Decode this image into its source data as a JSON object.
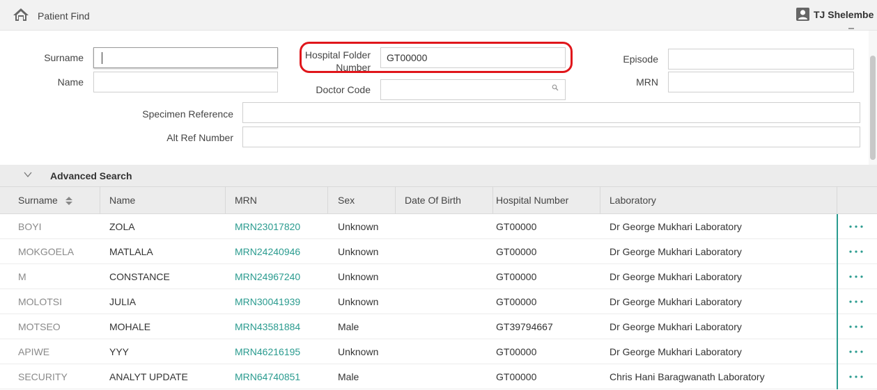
{
  "header": {
    "title": "Patient Find",
    "user": "TJ Shelembe"
  },
  "search": {
    "surname": {
      "label": "Surname",
      "value": ""
    },
    "name": {
      "label": "Name",
      "value": ""
    },
    "hospital_folder_number": {
      "label_line1": "Hospital Folder",
      "label_line2": "Number",
      "value": "GT00000"
    },
    "doctor_code": {
      "label": "Doctor Code",
      "value": ""
    },
    "episode": {
      "label": "Episode",
      "value": ""
    },
    "mrn": {
      "label": "MRN",
      "value": ""
    },
    "specimen_reference": {
      "label": "Specimen Reference",
      "value": ""
    },
    "alt_ref_number": {
      "label": "Alt Ref Number",
      "value": ""
    }
  },
  "advanced_search": {
    "label": "Advanced Search"
  },
  "table": {
    "columns": [
      "Surname",
      "Name",
      "MRN",
      "Sex",
      "Date Of Birth",
      "Hospital Number",
      "Laboratory"
    ],
    "rows": [
      {
        "surname": "BOYI",
        "name": "ZOLA",
        "mrn": "MRN23017820",
        "sex": "Unknown",
        "dob": "",
        "hospital_number": "GT00000",
        "laboratory": "Dr George Mukhari Laboratory"
      },
      {
        "surname": "MOKGOELA",
        "name": "MATLALA",
        "mrn": "MRN24240946",
        "sex": "Unknown",
        "dob": "",
        "hospital_number": "GT00000",
        "laboratory": "Dr George Mukhari Laboratory"
      },
      {
        "surname": "M",
        "name": "CONSTANCE",
        "mrn": "MRN24967240",
        "sex": "Unknown",
        "dob": "",
        "hospital_number": "GT00000",
        "laboratory": "Dr George Mukhari Laboratory"
      },
      {
        "surname": "MOLOTSI",
        "name": "JULIA",
        "mrn": "MRN30041939",
        "sex": "Unknown",
        "dob": "",
        "hospital_number": "GT00000",
        "laboratory": "Dr George Mukhari Laboratory"
      },
      {
        "surname": "MOTSEO",
        "name": "MOHALE",
        "mrn": "MRN43581884",
        "sex": "Male",
        "dob": "",
        "hospital_number": "GT39794667",
        "laboratory": "Dr George Mukhari Laboratory"
      },
      {
        "surname": "APIWE",
        "name": "YYY",
        "mrn": "MRN46216195",
        "sex": "Unknown",
        "dob": "",
        "hospital_number": "GT00000",
        "laboratory": "Dr George Mukhari Laboratory"
      },
      {
        "surname": "SECURITY",
        "name": "ANALYT UPDATE",
        "mrn": "MRN64740851",
        "sex": "Male",
        "dob": "",
        "hospital_number": "GT00000",
        "laboratory": "Chris Hani Baragwanath Laboratory"
      }
    ]
  },
  "icons": {
    "home": "home-icon",
    "user": "user-icon",
    "search": "search-icon",
    "chevron": "chevron-down-icon",
    "sort": "sort-icon",
    "more": "more-dots-icon"
  },
  "colors": {
    "accent": "#2a9b8f",
    "highlight": "#e0161b"
  }
}
